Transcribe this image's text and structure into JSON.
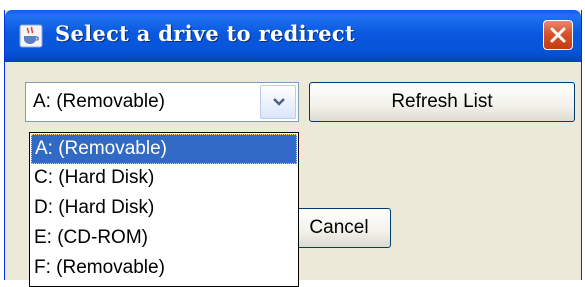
{
  "dialog": {
    "title": "Select a drive to redirect",
    "icon": "java-cup-icon",
    "close_icon": "close-icon"
  },
  "drive_select": {
    "selected_value": "A: (Removable)",
    "options": [
      "A: (Removable)",
      "C: (Hard Disk)",
      "D: (Hard Disk)",
      "E: (CD-ROM)",
      "F: (Removable)"
    ],
    "highlighted_index": 0
  },
  "buttons": {
    "refresh_label": "Refresh List",
    "cancel_label": "Cancel"
  },
  "colors": {
    "titlebar": "#0a58df",
    "close_button": "#d9522a",
    "selection": "#316ac5",
    "dialog_background": "#ece9d8"
  }
}
